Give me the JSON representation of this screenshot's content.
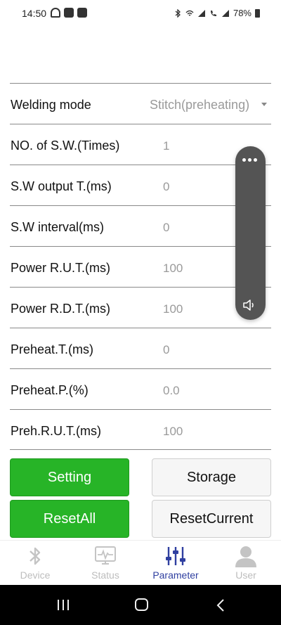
{
  "status_bar": {
    "time": "14:50",
    "battery": "78%",
    "icons": [
      "notification-icon",
      "gallery-icon",
      "app-icon",
      "bluetooth-icon",
      "wifi-icon",
      "signal-icon",
      "call-icon",
      "signal2-icon",
      "battery-icon"
    ]
  },
  "form": {
    "rows": [
      {
        "label": "Welding mode",
        "value": "Stitch(preheating)",
        "type": "select"
      },
      {
        "label": "NO. of S.W.(Times)",
        "value": "1"
      },
      {
        "label": "S.W output T.(ms)",
        "value": "0"
      },
      {
        "label": "S.W interval(ms)",
        "value": "0"
      },
      {
        "label": "Power R.U.T.(ms)",
        "value": "100"
      },
      {
        "label": "Power R.D.T.(ms)",
        "value": "100"
      },
      {
        "label": "Preheat.T.(ms)",
        "value": "0"
      },
      {
        "label": "Preheat.P.(%)",
        "value": "0.0"
      },
      {
        "label": "Preh.R.U.T.(ms)",
        "value": "100"
      }
    ]
  },
  "buttons": {
    "setting": "Setting",
    "storage": "Storage",
    "reset_all": "ResetAll",
    "reset_current": "ResetCurrent"
  },
  "tabs": [
    {
      "label": "Device",
      "icon": "bluetooth-icon",
      "active": false
    },
    {
      "label": "Status",
      "icon": "monitor-icon",
      "active": false
    },
    {
      "label": "Parameter",
      "icon": "sliders-icon",
      "active": true
    },
    {
      "label": "User",
      "icon": "user-icon",
      "active": false
    }
  ],
  "colors": {
    "primary_green": "#27b427",
    "active_tab": "#2f3fa0",
    "inactive_tab": "#bdbdbd",
    "value_grey": "#9a9a9a"
  }
}
